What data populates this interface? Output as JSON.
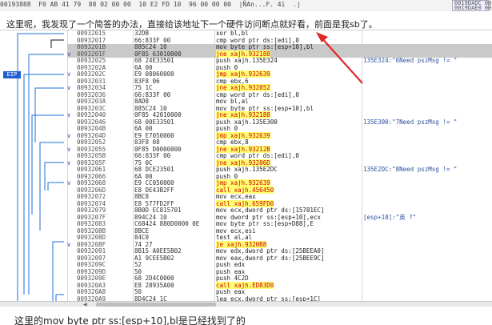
{
  "top_strip": {
    "left_text": "00193888  F0 AB 41 79  88 02 00 00  10 E2 FD 10  96 00 00 00  |ÑAn...F. 4ì  .|",
    "left_text2": "0019389?  40 A0 0B 00  3D 3B 12 CC  4B 14 D9 19  05 ",
    "right_box": "0019DADC 00\n0019DAE0 00"
  },
  "caption_top": "这里呢，我发现了一个简答的办法，直接给该地址下一个硬件访问断点就好看，前面是我sb了。",
  "caption_bottom": "这里的mov byte ptr ss:[esp+10],bl是已经找到了的",
  "eip_label": "EIP",
  "rows": [
    {
      "mk": "",
      "addr": "00932015",
      "hex": "32DB",
      "asm": "xor bl,bl",
      "cmt": ""
    },
    {
      "mk": "",
      "addr": "00932017",
      "hex": "66:833F 00",
      "asm": "cmp word ptr ds:[edi],0",
      "cmt": ""
    },
    {
      "mk": "",
      "addr": "0093201B",
      "hex": "885C24 10",
      "asm": "mov byte ptr ss:[esp+10],bl",
      "cmt": ""
    },
    {
      "mk": "v",
      "addr": "0093201F",
      "hex": "0F85 63010000",
      "asm": "jne xajh.932188",
      "cmt": ""
    },
    {
      "mk": "",
      "addr": "00932025",
      "hex": "68 24E33501",
      "asm": "push xajh.135E324",
      "cmt": "135E324:\"6Need pszMsg != \""
    },
    {
      "mk": "",
      "addr": "0093202A",
      "hex": "6A 00",
      "asm": "push 0",
      "cmt": ""
    },
    {
      "mk": "v",
      "addr": "0093202C",
      "hex": "E9 08060000",
      "asm": "jmp xajh.932639",
      "cmt": ""
    },
    {
      "mk": "",
      "addr": "00932031",
      "hex": "83F8 06",
      "asm": "cmp ebx,6",
      "cmt": ""
    },
    {
      "mk": "v",
      "addr": "00932034",
      "hex": "75 1C",
      "asm": "jne xajh.932052",
      "cmt": ""
    },
    {
      "mk": "",
      "addr": "00932036",
      "hex": "66:833F 00",
      "asm": "cmp word ptr ds:[edi],0",
      "cmt": ""
    },
    {
      "mk": "",
      "addr": "0093203A",
      "hex": "8AD8",
      "asm": "mov bl,al",
      "cmt": ""
    },
    {
      "mk": "",
      "addr": "0093203C",
      "hex": "885C24 10",
      "asm": "mov byte ptr ss:[esp+10],bl",
      "cmt": ""
    },
    {
      "mk": "v",
      "addr": "00932040",
      "hex": "0F85 42010000",
      "asm": "jne xajh.932188",
      "cmt": ""
    },
    {
      "mk": "",
      "addr": "00932046",
      "hex": "68 00E33501",
      "asm": "push xajh.135E300",
      "cmt": "135E300:\"7Need pszMsg != \""
    },
    {
      "mk": "",
      "addr": "0093204B",
      "hex": "6A 00",
      "asm": "push 0",
      "cmt": ""
    },
    {
      "mk": "v",
      "addr": "0093204D",
      "hex": "E9 E7050000",
      "asm": "jmp xajh.932639",
      "cmt": ""
    },
    {
      "mk": "",
      "addr": "00932052",
      "hex": "83F8 08",
      "asm": "cmp ebx,8",
      "cmt": ""
    },
    {
      "mk": "v",
      "addr": "00932055",
      "hex": "0F85 D0000000",
      "asm": "jne xajh.93212B",
      "cmt": ""
    },
    {
      "mk": "",
      "addr": "0093205B",
      "hex": "66:833F 00",
      "asm": "cmp word ptr ds:[edi],0",
      "cmt": ""
    },
    {
      "mk": "v",
      "addr": "0093205F",
      "hex": "75 0C",
      "asm": "jne xajh.93206D",
      "cmt": ""
    },
    {
      "mk": "",
      "addr": "00932061",
      "hex": "68 DCE23501",
      "asm": "push xajh.135E2DC",
      "cmt": "135E2DC:\"8Need pszMsg != \""
    },
    {
      "mk": "",
      "addr": "00932066",
      "hex": "6A 00",
      "asm": "push 0",
      "cmt": ""
    },
    {
      "mk": "v",
      "addr": "00932068",
      "hex": "E9 CC050000",
      "asm": "jmp xajh.932639",
      "cmt": ""
    },
    {
      "mk": "",
      "addr": "0093206D",
      "hex": "E8 DE43B2FF",
      "asm": "call xajh.456450",
      "cmt": ""
    },
    {
      "mk": "",
      "addr": "00932072",
      "hex": "8BC8",
      "asm": "mov ecx,eax",
      "cmt": ""
    },
    {
      "mk": "",
      "addr": "00932074",
      "hex": "E8 577FD2FF",
      "asm": "call xajh.659FD0",
      "cmt": ""
    },
    {
      "mk": "",
      "addr": "00932079",
      "hex": "8B0D EC815701",
      "asm": "mov ecx,dword ptr ds:[15781EC]",
      "cmt": ""
    },
    {
      "mk": "",
      "addr": "0093207F",
      "hex": "894C24 10",
      "asm": "mov dword ptr ss:[esp+10],ecx",
      "cmt": "[esp+10]:\"英 ?\""
    },
    {
      "mk": "",
      "addr": "00932083",
      "hex": "C68424 880D0000 0E",
      "asm": "mov byte ptr ss:[esp+D88],E",
      "cmt": ""
    },
    {
      "mk": "",
      "addr": "0093208B",
      "hex": "8BCE",
      "asm": "mov ecx,esi",
      "cmt": ""
    },
    {
      "mk": "",
      "addr": "0093208D",
      "hex": "84C0",
      "asm": "test al,al",
      "cmt": ""
    },
    {
      "mk": "v",
      "addr": "0093208F",
      "hex": "74 27",
      "asm": "je xajh.9320B8",
      "cmt": ""
    },
    {
      "mk": "",
      "addr": "00932091",
      "hex": "8B15 A0EE5B02",
      "asm": "mov edx,dword ptr ds:[25BEEA0]",
      "cmt": ""
    },
    {
      "mk": "",
      "addr": "00932097",
      "hex": "A1 9CEE5B02",
      "asm": "mov eax,dword ptr ds:[25BEE9C]",
      "cmt": ""
    },
    {
      "mk": "",
      "addr": "0093209C",
      "hex": "52",
      "asm": "push edx",
      "cmt": ""
    },
    {
      "mk": "",
      "addr": "0093209D",
      "hex": "50",
      "asm": "push eax",
      "cmt": ""
    },
    {
      "mk": "",
      "addr": "0093209E",
      "hex": "68 2D4C0000",
      "asm": "push 4C2D",
      "cmt": ""
    },
    {
      "mk": "",
      "addr": "009320A3",
      "hex": "E8 28935A00",
      "asm": "call xajh.ED83D0",
      "cmt": ""
    },
    {
      "mk": "",
      "addr": "009320A8",
      "hex": "50",
      "asm": "push eax",
      "cmt": ""
    },
    {
      "mk": "",
      "addr": "009320A9",
      "hex": "8D4C24 1C",
      "asm": "lea ecx,dword ptr ss:[esp+1C]",
      "cmt": ""
    },
    {
      "mk": "",
      "addr": "009320AD",
      "hex": "51",
      "asm": "push ecx",
      "cmt": ""
    },
    {
      "mk": "",
      "addr": "009320AE",
      "hex": "E8 FD486300",
      "asm": "call xajh.F669B0",
      "cmt": ""
    },
    {
      "mk": "",
      "addr": "009320B3",
      "hex": "83C4 10",
      "asm": "add esp,10",
      "cmt": ""
    },
    {
      "mk": "v",
      "addr": "009320B6",
      "hex": "EB 14",
      "asm": "jmp xajh.9320CC",
      "cmt": ""
    }
  ]
}
